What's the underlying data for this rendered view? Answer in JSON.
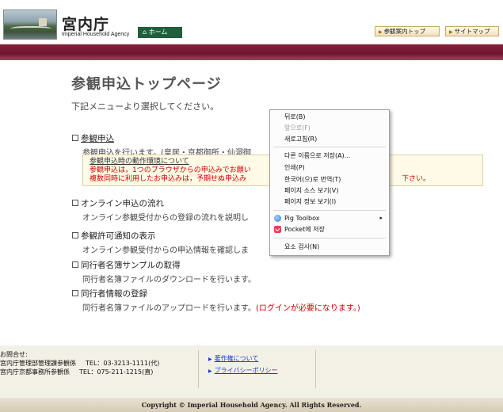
{
  "header": {
    "site_name": "宮内庁",
    "site_name_en": "Imperial Household Agency",
    "home_label": "ホーム",
    "links": [
      "参観案内トップ",
      "サイトマップ"
    ]
  },
  "main": {
    "title": "参観申込トップページ",
    "intro": "下記メニューより選択してください。",
    "items": [
      {
        "title": "参観申込",
        "desc": "参観申込を行います。(皇居・京都御所・仙洞御"
      },
      {
        "title": "オンライン申込の流れ",
        "desc": "オンライン参観受付からの登録の流れを説明し"
      },
      {
        "title": "参観許可通知の表示",
        "desc": "オンライン参観受付からの申込情報を確認しま",
        "desc_tail": "。)"
      },
      {
        "title": "同行者名簿サンプルの取得",
        "desc": "同行者名簿ファイルのダウンロードを行います。"
      },
      {
        "title": "同行者情報の登録",
        "desc": "同行者名簿ファイルのアップロードを行います。",
        "desc_red": "(ログインが必要になります。)"
      }
    ],
    "notice": {
      "title": "参観申込時の動作環境について",
      "line1": "参観申込は，1つのブラウザからの申込みでお願い",
      "line2": "複数同時に利用したお申込みは，予期せぬ申込み",
      "line2_tail": "下さい。"
    }
  },
  "context_menu": {
    "items": [
      {
        "label": "뒤로(B)",
        "disabled": false
      },
      {
        "label": "앞으로(F)",
        "disabled": true
      },
      {
        "label": "새로고침(R)",
        "disabled": false
      },
      {
        "label": "다른 이름으로 저장(A)...",
        "disabled": false
      },
      {
        "label": "인쇄(P)",
        "disabled": false
      },
      {
        "label": "한국어(으)로 번역(T)",
        "disabled": false
      },
      {
        "label": "페이지 소스 보기(V)",
        "disabled": false
      },
      {
        "label": "페이지 정보 보기(I)",
        "disabled": false
      },
      {
        "label": "Pig Toolbox",
        "disabled": false,
        "icon": "pig-toolbox-icon",
        "submenu": true
      },
      {
        "label": "Pocket에 저장",
        "disabled": false,
        "icon": "pocket-icon"
      },
      {
        "label": "요소 검사(N)",
        "disabled": false
      }
    ]
  },
  "footer": {
    "contact_label": "お問合せ:",
    "contacts": [
      {
        "dept": "宮内庁管理部管理課参観係",
        "tel": "TEL：03-3213-1111(代)"
      },
      {
        "dept": "宮内庁京都事務所参観係",
        "tel": "TEL：075-211-1215(直)"
      }
    ],
    "links": [
      "著作権について",
      "プライバシーポリシー"
    ],
    "copyright": "Copyright © Imperial Household Agency. All Rights Reserved."
  },
  "colors": {
    "band": "#6d1530",
    "home_button": "#1f5f3a",
    "notice_red": "#cc0000",
    "link_blue": "#1a3cc8"
  }
}
